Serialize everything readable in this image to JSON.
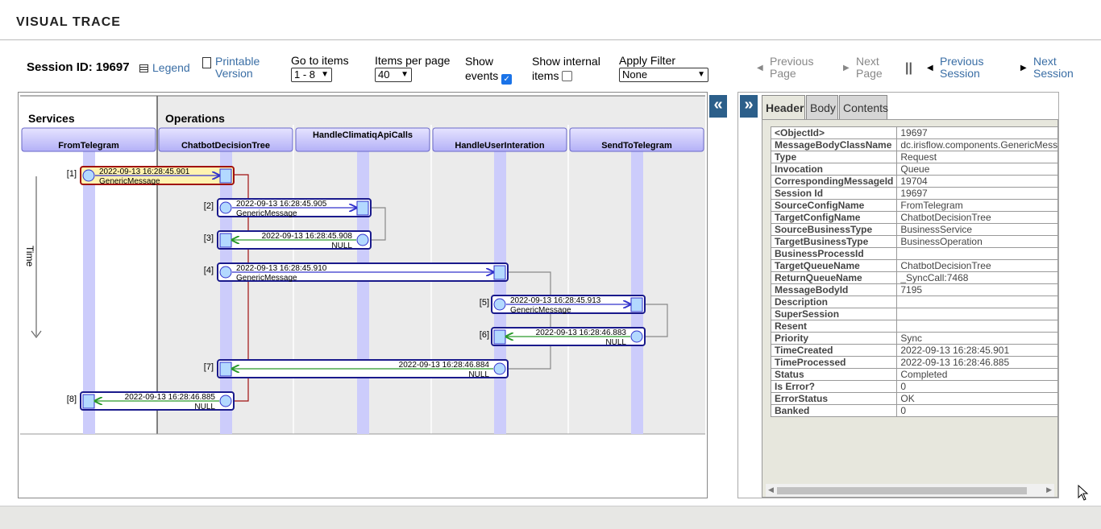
{
  "header": {
    "title": "VISUAL TRACE"
  },
  "toolbar": {
    "session_id": "Session ID: 19697",
    "legend": "Legend",
    "printable_line1": "Printable",
    "printable_line2": "Version",
    "goto_label": "Go to items",
    "goto_value": "1 - 8",
    "ipp_label": "Items per page",
    "ipp_value": "40",
    "show_events_line1": "Show",
    "show_events_line2": "events",
    "show_internal_line1": "Show internal",
    "show_internal_line2": "items",
    "filter_label": "Apply Filter",
    "filter_value": "None",
    "prev_page_1": "Previous",
    "prev_page_2": "Page",
    "next_page_1": "Next",
    "next_page_2": "Page",
    "separator": "||",
    "prev_session_1": "Previous",
    "prev_session_2": "Session",
    "next_session_1": "Next",
    "next_session_2": "Session"
  },
  "diagram": {
    "services_label": "Services",
    "operations_label": "Operations",
    "time_label": "Time",
    "columns": [
      "FromTelegram",
      "ChatbotDecisionTree",
      "HandleClimatiqApiCalls",
      "HandleUserInteration",
      "SendToTelegram"
    ],
    "messages": [
      {
        "index": "[1]",
        "time": "2022-09-13 16:28:45.901",
        "label": "GenericMessage"
      },
      {
        "index": "[2]",
        "time": "2022-09-13 16:28:45.905",
        "label": "GenericMessage"
      },
      {
        "index": "[3]",
        "time": "2022-09-13 16:28:45.908",
        "label": "NULL"
      },
      {
        "index": "[4]",
        "time": "2022-09-13 16:28:45.910",
        "label": "GenericMessage"
      },
      {
        "index": "[5]",
        "time": "2022-09-13 16:28:45.913",
        "label": "GenericMessage"
      },
      {
        "index": "[6]",
        "time": "2022-09-13 16:28:46.883",
        "label": "NULL"
      },
      {
        "index": "[7]",
        "time": "2022-09-13 16:28:46.884",
        "label": "NULL"
      },
      {
        "index": "[8]",
        "time": "2022-09-13 16:28:46.885",
        "label": "NULL"
      }
    ],
    "collapse_icon": "«"
  },
  "panel": {
    "expand_icon": "»",
    "tabs": [
      "Header",
      "Body",
      "Contents"
    ],
    "properties": [
      [
        "<ObjectId>",
        "19697"
      ],
      [
        "MessageBodyClassName",
        "dc.irisflow.components.GenericMessage"
      ],
      [
        "Type",
        "Request"
      ],
      [
        "Invocation",
        "Queue"
      ],
      [
        "CorrespondingMessageId",
        "19704"
      ],
      [
        "Session Id",
        "19697"
      ],
      [
        "SourceConfigName",
        "FromTelegram"
      ],
      [
        "TargetConfigName",
        "ChatbotDecisionTree"
      ],
      [
        "SourceBusinessType",
        "BusinessService"
      ],
      [
        "TargetBusinessType",
        "BusinessOperation"
      ],
      [
        "BusinessProcessId",
        ""
      ],
      [
        "TargetQueueName",
        "ChatbotDecisionTree"
      ],
      [
        "ReturnQueueName",
        "_SyncCall:7468"
      ],
      [
        "MessageBodyId",
        "7195"
      ],
      [
        "Description",
        ""
      ],
      [
        "SuperSession",
        ""
      ],
      [
        "Resent",
        ""
      ],
      [
        "Priority",
        "Sync"
      ],
      [
        "TimeCreated",
        "2022-09-13 16:28:45.901"
      ],
      [
        "TimeProcessed",
        "2022-09-13 16:28:46.885"
      ],
      [
        "Status",
        "Completed"
      ],
      [
        "Is Error?",
        "0"
      ],
      [
        "ErrorStatus",
        "OK"
      ],
      [
        "Banked",
        "0"
      ]
    ]
  },
  "colors": {
    "accent": "#2c5f8a",
    "link": "#3a6ea5",
    "request": "#3333cc",
    "response": "#2a9a2a",
    "selected_fill": "#fff3b0",
    "selected_border": "#a01010"
  }
}
